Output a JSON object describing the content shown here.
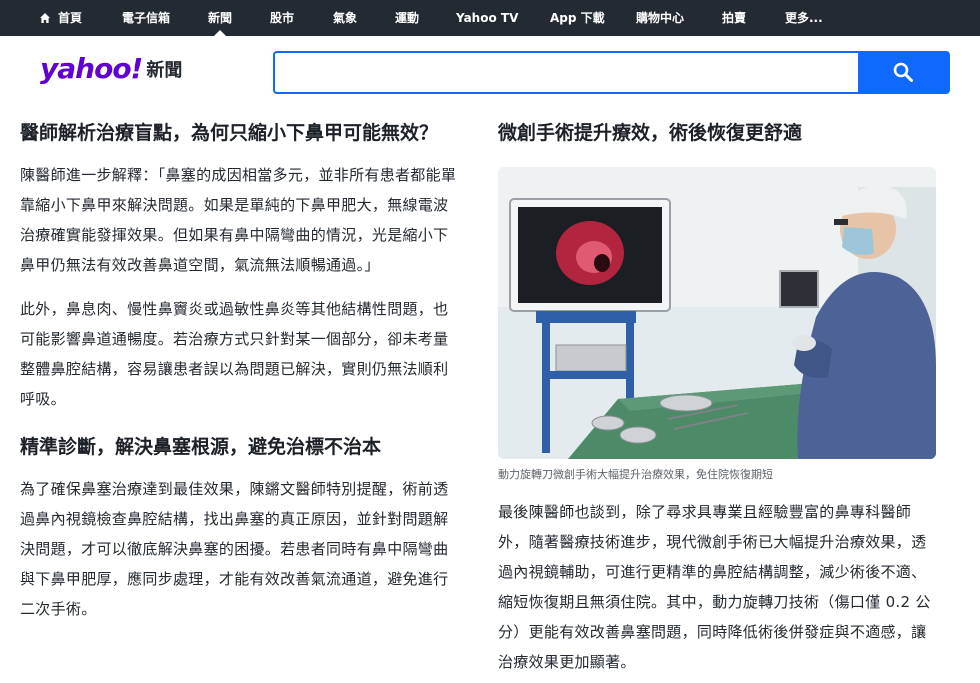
{
  "nav": {
    "items": [
      {
        "label": "首頁",
        "icon": "home-icon"
      },
      {
        "label": "電子信箱"
      },
      {
        "label": "新聞",
        "active": true
      },
      {
        "label": "股市"
      },
      {
        "label": "氣象"
      },
      {
        "label": "運動"
      },
      {
        "label": "Yahoo TV"
      },
      {
        "label": "App 下載"
      },
      {
        "label": "購物中心"
      },
      {
        "label": "拍賣"
      },
      {
        "label": "更多..."
      }
    ]
  },
  "header": {
    "logo_word": "yahoo!",
    "logo_section": "新聞",
    "search_value": "",
    "search_icon": "search-icon"
  },
  "colors": {
    "nav_bg": "#232a31",
    "brand_purple": "#6001d2",
    "accent_blue": "#0f69ff",
    "caption_gray": "#5b636a"
  },
  "left": {
    "heading1": "醫師解析治療盲點，為何只縮小下鼻甲可能無效？",
    "para1": "陳醫師進一步解釋：「鼻塞的成因相當多元，並非所有患者都能單靠縮小下鼻甲來解決問題。如果是單純的下鼻甲肥大，無線電波治療確實能發揮效果。但如果有鼻中隔彎曲的情況，光是縮小下鼻甲仍無法有效改善鼻道空間，氣流無法順暢通過。」",
    "para2": "此外，鼻息肉、慢性鼻竇炎或過敏性鼻炎等其他結構性問題，也可能影響鼻道通暢度。若治療方式只針對某一個部分，卻未考量整體鼻腔結構，容易讓患者誤以為問題已解決，實則仍無法順利呼吸。",
    "heading2": "精準診斷，解決鼻塞根源，避免治標不治本",
    "para3": "為了確保鼻塞治療達到最佳效果，陳鏘文醫師特別提醒，術前透過鼻內視鏡檢查鼻腔結構，找出鼻塞的真正原因，並針對問題解決問題，才可以徹底解決鼻塞的困擾。若患者同時有鼻中隔彎曲與下鼻甲肥厚，應同步處理，才能有效改善氣流通道，避免進行二次手術。"
  },
  "right": {
    "heading": "微創手術提升療效，術後恢復更舒適",
    "image_alt": "surgeon-with-endoscope-monitor",
    "caption": "動力旋轉刀微創手術大幅提升治療效果，免住院恢復期短",
    "para": "最後陳醫師也談到，除了尋求具專業且經驗豐富的鼻專科醫師外，隨著醫療技術進步，現代微創手術已大幅提升治療效果，透過內視鏡輔助，可進行更精準的鼻腔結構調整，減少術後不適、縮短恢復期且無須住院。其中，動力旋轉刀技術（傷口僅 0.2 公分）更能有效改善鼻塞問題，同時降低術後併發症與不適感，讓治療效果更加顯著。"
  }
}
